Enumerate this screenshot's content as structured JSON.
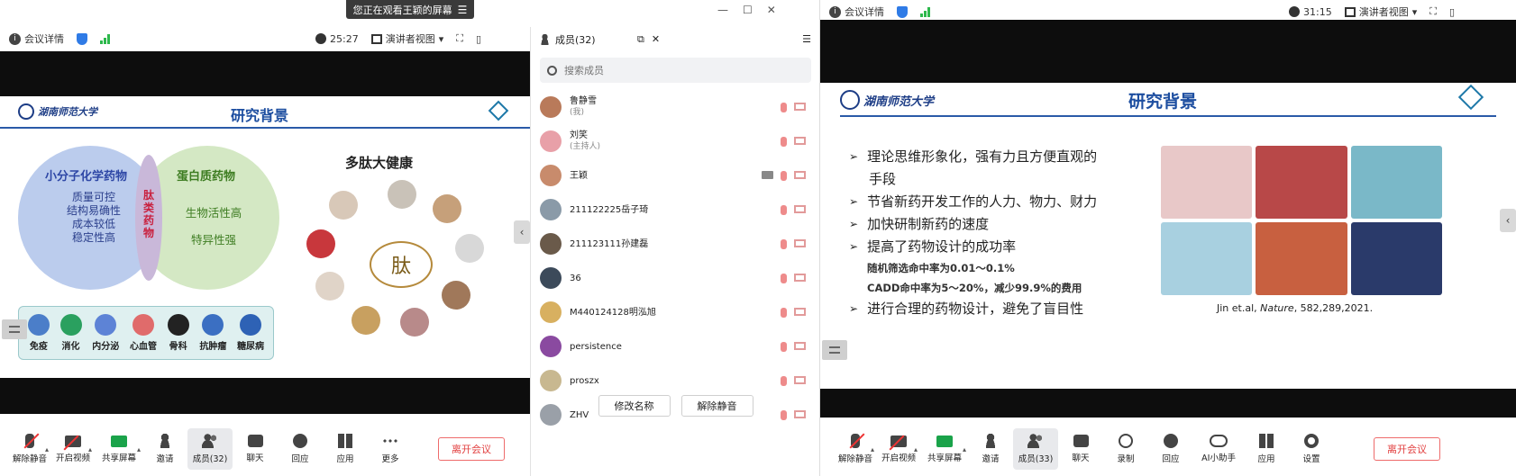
{
  "left": {
    "share_banner": "您正在观看王颖的屏幕",
    "meeting_info_label": "会议详情",
    "timer": "25:27",
    "view_label": "演讲者视图",
    "slide": {
      "title": "研究背景",
      "venn_left_title": "小分子化学药物",
      "venn_left_lines": [
        "质量可控",
        "结构易确性",
        "成本较低",
        "稳定性高"
      ],
      "venn_mid_lines": [
        "肽",
        "类",
        "药",
        "物"
      ],
      "venn_right_title": "蛋白质药物",
      "venn_right_lines": [
        "生物活性高",
        "特异性强"
      ],
      "categories": [
        "免疫",
        "消化",
        "内分泌",
        "心血管",
        "骨科",
        "抗肿瘤",
        "糖尿病"
      ],
      "category_colors": [
        "#4b7ec9",
        "#2aa05f",
        "#5d83d6",
        "#e06b6b",
        "#222222",
        "#3b6fc2",
        "#2e62b5"
      ],
      "peptide_title": "多肽大健康",
      "peptide_center": "肽"
    },
    "panel": {
      "title": "成员(32)",
      "search_placeholder": "搜索成员",
      "members": [
        {
          "name": "鲁静雪",
          "sub": "(我)",
          "color": "#b97a5a",
          "share": false
        },
        {
          "name": "刘笑",
          "sub": "(主持人)",
          "color": "#e8a0a8",
          "share": false
        },
        {
          "name": "王颖",
          "sub": "",
          "color": "#c88b6c",
          "share": true
        },
        {
          "name": "211122225岳子琦",
          "sub": "",
          "color": "#8a9aa8",
          "share": false
        },
        {
          "name": "211123111孙建磊",
          "sub": "",
          "color": "#6a5a4a",
          "share": false
        },
        {
          "name": "36",
          "sub": "",
          "color": "#3c4a5a",
          "share": false
        },
        {
          "name": "M440124128明泓旭",
          "sub": "",
          "color": "#d8b060",
          "share": false
        },
        {
          "name": "persistence",
          "sub": "",
          "color": "#8a4aa0",
          "share": false
        },
        {
          "name": "proszx",
          "sub": "",
          "color": "#c8b890",
          "share": false
        },
        {
          "name": "ZHV",
          "sub": "",
          "color": "#9aa0a8",
          "share": false
        }
      ],
      "rename_label": "修改名称",
      "unmute_label": "解除静音"
    },
    "toolbar": {
      "unmute": "解除静音",
      "start_video": "开启视频",
      "share_screen": "共享屏幕",
      "invite": "邀请",
      "members": "成员(32)",
      "chat": "聊天",
      "react": "回应",
      "apps": "应用",
      "more": "更多",
      "leave": "离开会议"
    }
  },
  "right": {
    "meeting_info_label": "会议详情",
    "timer": "31:15",
    "view_label": "演讲者视图",
    "slide": {
      "title": "研究背景",
      "bullets": [
        "理论思维形象化，强有力且方便直观的",
        "手段",
        "节省新药开发工作的人力、物力、财力",
        "加快研制新药的速度",
        "提高了药物设计的成功率"
      ],
      "sub_lines": [
        "随机筛选命中率为0.01～0.1%",
        "CADD命中率为5～20%，减少99.9%的费用"
      ],
      "last_bullet": "进行合理的药物设计，避免了盲目性",
      "citation_prefix": "Jin et.al, ",
      "citation_journal": "Nature",
      "citation_suffix": ", 582,289,2021.",
      "mol_colors": [
        "#e8c8c8",
        "#b84848",
        "#7ab8c8",
        "#a8d0e0",
        "#c86040",
        "#2a3a6a"
      ]
    },
    "toolbar": {
      "unmute": "解除静音",
      "start_video": "开启视频",
      "share_screen": "共享屏幕",
      "invite": "邀请",
      "members": "成员(33)",
      "chat": "聊天",
      "record": "录制",
      "react": "回应",
      "ai": "AI小助手",
      "apps": "应用",
      "settings": "设置",
      "leave": "离开会议"
    }
  }
}
